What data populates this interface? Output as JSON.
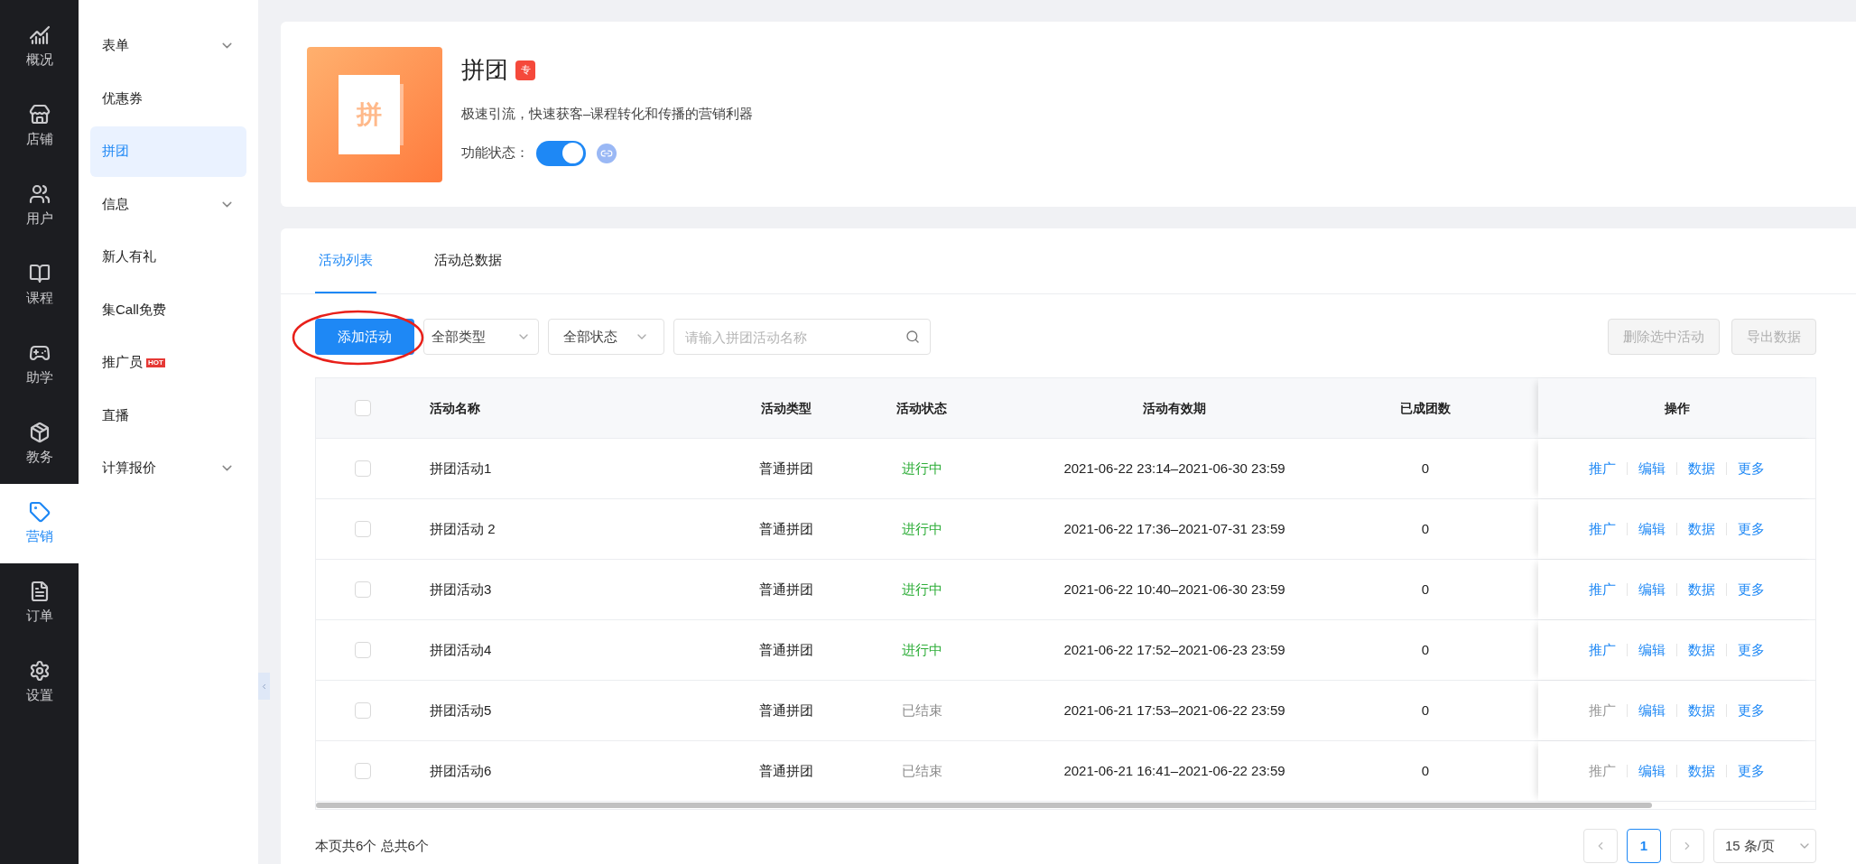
{
  "rail": [
    {
      "label": "概况",
      "selected": false
    },
    {
      "label": "店铺",
      "selected": false
    },
    {
      "label": "用户",
      "selected": false
    },
    {
      "label": "课程",
      "selected": false
    },
    {
      "label": "助学",
      "selected": false
    },
    {
      "label": "教务",
      "selected": false
    },
    {
      "label": "营销",
      "selected": true
    },
    {
      "label": "订单",
      "selected": false
    },
    {
      "label": "设置",
      "selected": false
    }
  ],
  "submenu": [
    {
      "label": "表单",
      "expandable": true,
      "selected": false
    },
    {
      "label": "优惠券",
      "expandable": false,
      "selected": false
    },
    {
      "label": "拼团",
      "expandable": false,
      "selected": true
    },
    {
      "label": "信息",
      "expandable": true,
      "selected": false
    },
    {
      "label": "新人有礼",
      "expandable": false,
      "selected": false
    },
    {
      "label": "集Call免费",
      "expandable": false,
      "selected": false
    },
    {
      "label": "推广员",
      "expandable": false,
      "selected": false,
      "badge": "HOT"
    },
    {
      "label": "直播",
      "expandable": false,
      "selected": false
    },
    {
      "label": "计算报价",
      "expandable": true,
      "selected": false
    }
  ],
  "feature": {
    "cover_glyph": "拼",
    "title": "拼团",
    "badge": "专",
    "description": "极速引流，快速获客–课程转化和传播的营销利器",
    "status_label": "功能状态：",
    "on": true
  },
  "tabs": [
    {
      "label": "活动列表",
      "selected": true
    },
    {
      "label": "活动总数据",
      "selected": false
    }
  ],
  "toolbar": {
    "add_button": "添加活动",
    "type_filter": "全部类型",
    "status_filter": "全部状态",
    "search": {
      "placeholder": "请输入拼团活动名称"
    },
    "actions": [
      {
        "label": "删除选中活动",
        "disabled": true
      },
      {
        "label": "导出数据",
        "disabled": true
      }
    ]
  },
  "table": {
    "columns": [
      "活动名称",
      "活动类型",
      "活动状态",
      "活动有效期",
      "已成团数",
      "操作"
    ],
    "header_checked": false,
    "rows": [
      {
        "checked": false,
        "name": "拼团活动1",
        "type": "普通拼团",
        "status": {
          "text": "进行中",
          "kind": "running"
        },
        "period": "2021-06-22 23:14–2021-06-30 23:59",
        "groups": "0",
        "actions": [
          {
            "label": "推广",
            "disabled": false
          },
          {
            "label": "编辑",
            "disabled": false
          },
          {
            "label": "数据",
            "disabled": false
          },
          {
            "label": "更多",
            "disabled": false
          }
        ]
      },
      {
        "checked": false,
        "name": "拼团活动 2",
        "type": "普通拼团",
        "status": {
          "text": "进行中",
          "kind": "running"
        },
        "period": "2021-06-22 17:36–2021-07-31 23:59",
        "groups": "0",
        "actions": [
          {
            "label": "推广",
            "disabled": false
          },
          {
            "label": "编辑",
            "disabled": false
          },
          {
            "label": "数据",
            "disabled": false
          },
          {
            "label": "更多",
            "disabled": false
          }
        ]
      },
      {
        "checked": false,
        "name": "拼团活动3",
        "type": "普通拼团",
        "status": {
          "text": "进行中",
          "kind": "running"
        },
        "period": "2021-06-22 10:40–2021-06-30 23:59",
        "groups": "0",
        "actions": [
          {
            "label": "推广",
            "disabled": false
          },
          {
            "label": "编辑",
            "disabled": false
          },
          {
            "label": "数据",
            "disabled": false
          },
          {
            "label": "更多",
            "disabled": false
          }
        ]
      },
      {
        "checked": false,
        "name": "拼团活动4",
        "type": "普通拼团",
        "status": {
          "text": "进行中",
          "kind": "running"
        },
        "period": "2021-06-22 17:52–2021-06-23 23:59",
        "groups": "0",
        "actions": [
          {
            "label": "推广",
            "disabled": false
          },
          {
            "label": "编辑",
            "disabled": false
          },
          {
            "label": "数据",
            "disabled": false
          },
          {
            "label": "更多",
            "disabled": false
          }
        ]
      },
      {
        "checked": false,
        "name": "拼团活动5",
        "type": "普通拼团",
        "status": {
          "text": "已结束",
          "kind": "ended"
        },
        "period": "2021-06-21 17:53–2021-06-22 23:59",
        "groups": "0",
        "actions": [
          {
            "label": "推广",
            "disabled": true
          },
          {
            "label": "编辑",
            "disabled": false
          },
          {
            "label": "数据",
            "disabled": false
          },
          {
            "label": "更多",
            "disabled": false
          }
        ]
      },
      {
        "checked": false,
        "name": "拼团活动6",
        "type": "普通拼团",
        "status": {
          "text": "已结束",
          "kind": "ended"
        },
        "period": "2021-06-21 16:41–2021-06-22 23:59",
        "groups": "0",
        "actions": [
          {
            "label": "推广",
            "disabled": true
          },
          {
            "label": "编辑",
            "disabled": false
          },
          {
            "label": "数据",
            "disabled": false
          },
          {
            "label": "更多",
            "disabled": false
          }
        ]
      }
    ]
  },
  "footer": {
    "summary": "本页共6个 总共6个",
    "pages": [
      {
        "label": "1",
        "selected": true
      }
    ],
    "page_size": "15 条/页"
  }
}
